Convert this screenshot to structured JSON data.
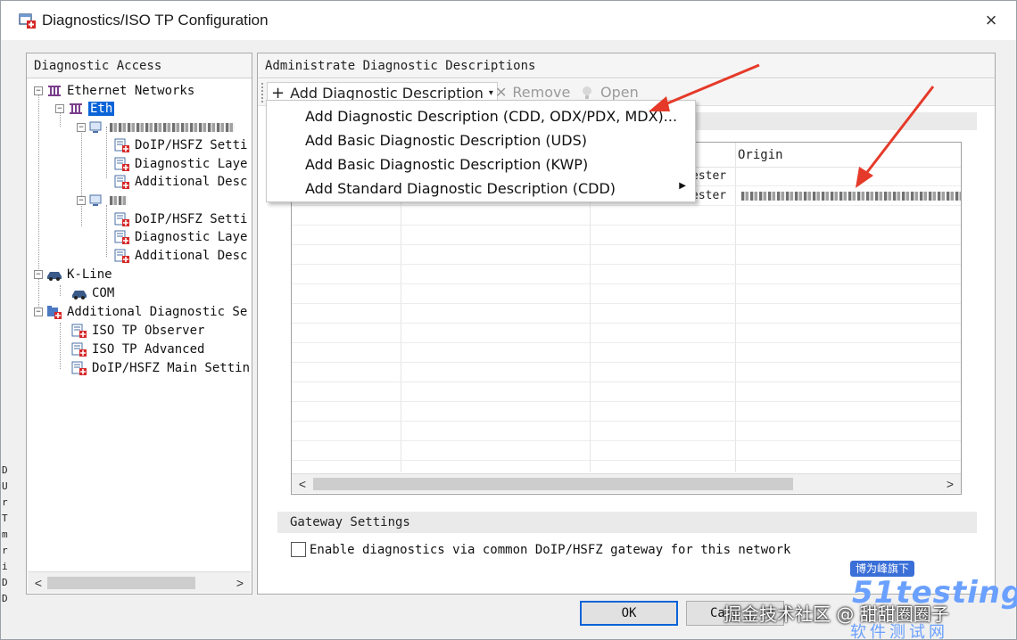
{
  "window": {
    "title": "Diagnostics/ISO TP Configuration",
    "close": "×"
  },
  "left": {
    "header": "Diagnostic Access",
    "tree": {
      "ethernet": "Ethernet Networks",
      "eth": "Eth",
      "doip1": "DoIP/HSFZ Setti",
      "diaglayer1": "Diagnostic Laye",
      "additional1": "Additional Desc",
      "doip2": "DoIP/HSFZ Setti",
      "diaglayer2": "Diagnostic Laye",
      "additional2": "Additional Desc",
      "kline": "K-Line",
      "com": "COM",
      "addl_services": "Additional Diagnostic Se",
      "isotp_observer": "ISO TP Observer",
      "isotp_advanced": "ISO TP Advanced",
      "doip_main": "DoIP/HSFZ Main Settin"
    },
    "scroll_left": "<",
    "scroll_right": ">"
  },
  "right": {
    "header": "Administrate Diagnostic Descriptions",
    "toolbar": {
      "add": "Add Diagnostic Description",
      "add_arrow": "▾",
      "remove": "Remove",
      "open": "Open"
    },
    "grid": {
      "origin_header": "Origin",
      "row1_col": "ester",
      "row2_col": "ester"
    },
    "scroll_left": "<",
    "scroll_right": ">",
    "gateway": {
      "header": "Gateway Settings",
      "checkbox_label": "Enable diagnostics via common DoIP/HSFZ gateway for this network",
      "checked": false
    }
  },
  "menu": {
    "items": [
      "Add Diagnostic Description (CDD, ODX/PDX, MDX)...",
      "Add Basic Diagnostic Description (UDS)",
      "Add Basic Diagnostic Description (KWP)",
      "Add Standard Diagnostic Description (CDD)"
    ],
    "submenu_arrow": "▶"
  },
  "buttons": {
    "ok": "OK",
    "cancel": "Ca"
  },
  "watermark": {
    "community": "掘金技术社区 @ 甜甜圈圈子",
    "tag": "博为峰旗下",
    "brand": "51testing",
    "sub": "软件测试网"
  },
  "colors": {
    "selection": "#0a64d8",
    "arrow": "#e53a2a"
  }
}
